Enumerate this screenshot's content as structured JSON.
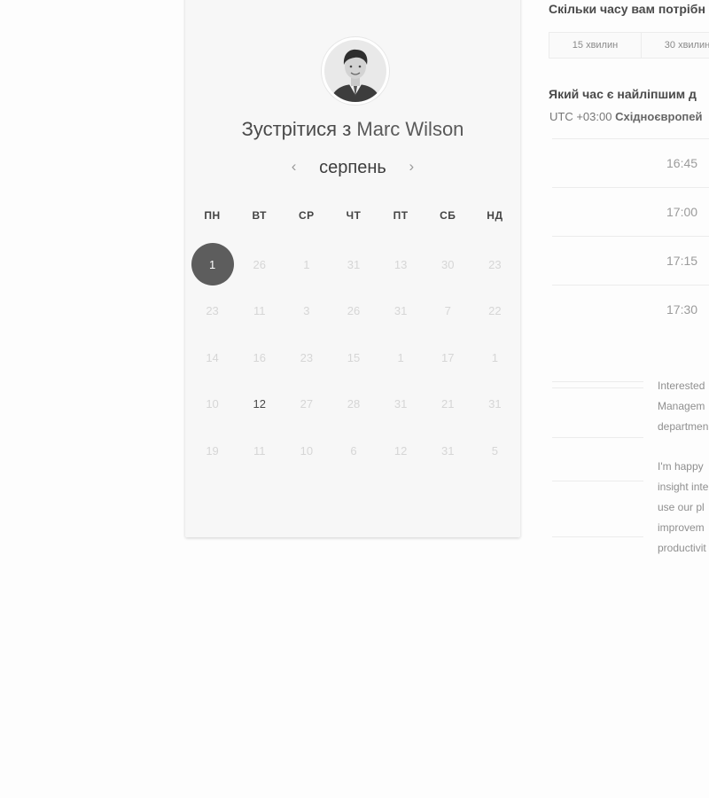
{
  "host": {
    "title_prefix": "Зустрітися з",
    "name": "Marc Wilson"
  },
  "calendar": {
    "month": "серпень",
    "prev_icon": "‹",
    "next_icon": "›",
    "weekdays": [
      "ПН",
      "ВТ",
      "СР",
      "ЧТ",
      "ПТ",
      "СБ",
      "НД"
    ],
    "weeks": [
      [
        "1",
        "26",
        "1",
        "31",
        "13",
        "30",
        "23"
      ],
      [
        "23",
        "11",
        "3",
        "26",
        "31",
        "7",
        "22"
      ],
      [
        "14",
        "16",
        "23",
        "15",
        "1",
        "17",
        "1"
      ],
      [
        "10",
        "12",
        "27",
        "28",
        "31",
        "21",
        "31"
      ],
      [
        "19",
        "11",
        "10",
        "6",
        "12",
        "31",
        "5"
      ]
    ],
    "selected_day": "1",
    "available_day": "12"
  },
  "duration": {
    "question": "Скільки часу вам потрібн",
    "options": [
      "15 хвилин",
      "30 хвилин"
    ]
  },
  "time": {
    "question": "Який час є найліпшим д",
    "timezone_offset": "UTC +03:00",
    "timezone_name": "Східноєвропей",
    "slots": [
      "16:45",
      "17:00",
      "17:15",
      "17:30"
    ]
  },
  "description": {
    "paragraph1": [
      "Interested",
      "Managem",
      "departmen"
    ],
    "paragraph2": [
      "I'm happy",
      "insight inte",
      "use our pl",
      "improvem",
      "productivit"
    ]
  },
  "colors": {
    "selected_day_bg": "#5d5d5d",
    "card_bg": "#f7f7f7",
    "inactive_day": "#d6d6d6"
  }
}
